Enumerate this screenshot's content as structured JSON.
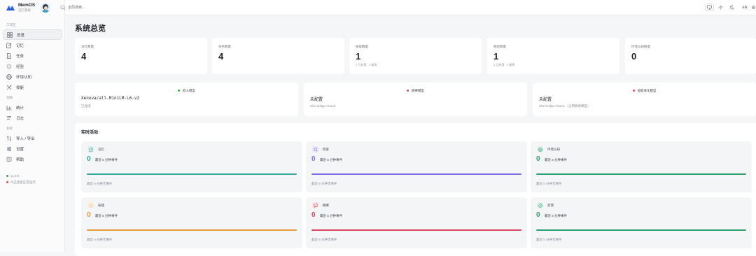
{
  "app": {
    "name": "MemOS",
    "subtitle": "记忆系统"
  },
  "search": {
    "placeholder": "全局搜索..."
  },
  "topbar": {
    "lang": "EN"
  },
  "sidebar": {
    "sections": [
      {
        "label": "工作区",
        "items": [
          {
            "label": "总览",
            "icon": "grid-icon",
            "active": true
          },
          {
            "label": "记忆",
            "icon": "edit-icon",
            "active": false
          },
          {
            "label": "任务",
            "icon": "document-icon",
            "active": false
          },
          {
            "label": "经验",
            "icon": "sparkle-icon",
            "active": false
          },
          {
            "label": "环境认知",
            "icon": "globe-icon",
            "active": false
          },
          {
            "label": "技能",
            "icon": "tools-icon",
            "active": false
          }
        ]
      },
      {
        "label": "洞察",
        "items": [
          {
            "label": "统计",
            "icon": "chart-icon",
            "active": false
          },
          {
            "label": "日志",
            "icon": "log-icon",
            "active": false
          }
        ]
      },
      {
        "label": "系统",
        "items": [
          {
            "label": "导入 / 导出",
            "icon": "transfer-icon",
            "active": false
          },
          {
            "label": "设置",
            "icon": "settings-icon",
            "active": false
          },
          {
            "label": "帮助",
            "icon": "book-icon",
            "active": false
          }
        ]
      }
    ],
    "status": [
      {
        "label": "v1.0.0",
        "color": "#2fb344"
      },
      {
        "label": "AI已连接正常运行",
        "color": "#e5484d"
      }
    ]
  },
  "main": {
    "title": "系统总览",
    "stats": [
      {
        "label": "记忆数量",
        "value": "4",
        "sub": ""
      },
      {
        "label": "任务数量",
        "value": "4",
        "sub": ""
      },
      {
        "label": "技能数量",
        "value": "1",
        "sub": "1 已启用 · 1 候选"
      },
      {
        "label": "经验数量",
        "value": "1",
        "sub": "1 已启用 · 2 候选"
      },
      {
        "label": "环境认知数量",
        "value": "0",
        "sub": ""
      }
    ],
    "models": [
      {
        "status": "嵌入模型",
        "status_color": "#2fb344",
        "name": "Xenova/all-MiniLM-L6-v2",
        "sub": "已连接",
        "mono": true
      },
      {
        "status": "摘要模型",
        "status_color": "#e5484d",
        "name": "未配置",
        "sub": "vibe bridge closed",
        "mono": false
      },
      {
        "status": "技能进化模型",
        "status_color": "#e5484d",
        "name": "未配置",
        "sub": "vibe bridge closed （沿用摘要模型）",
        "mono": false
      }
    ],
    "activity": {
      "title": "实时活动",
      "cards": [
        {
          "label": "记忆",
          "icon": "edit-icon",
          "count": "0",
          "count_sub": "最近 5 分钟事件",
          "footer": "最近 5 分钟无事件",
          "color": "#3aa6a0",
          "bg": "#dff1ef"
        },
        {
          "label": "检索",
          "icon": "search-icon",
          "count": "0",
          "count_sub": "最近 5 分钟事件",
          "footer": "最近 5 分钟无事件",
          "color": "#7c6fe0",
          "bg": "#eae6fb"
        },
        {
          "label": "环境认知",
          "icon": "globe-icon",
          "count": "0",
          "count_sub": "最近 5 分钟事件",
          "footer": "最近 5 分钟无事件",
          "color": "#2e9e6e",
          "bg": "#dff2e8"
        },
        {
          "label": "技能",
          "icon": "sparkle-icon",
          "count": "0",
          "count_sub": "最近 5 分钟事件",
          "footer": "最近 5 分钟无事件",
          "color": "#e39a3b",
          "bg": "#fbeedd"
        },
        {
          "label": "摘要",
          "icon": "chat-icon",
          "count": "0",
          "count_sub": "最近 5 分钟事件",
          "footer": "最近 5 分钟无事件",
          "color": "#d9455e",
          "bg": "#fbe2e6"
        },
        {
          "label": "反馈",
          "icon": "check-circle-icon",
          "count": "0",
          "count_sub": "最近 5 分钟事件",
          "footer": "最近 5 分钟无事件",
          "color": "#2e9e6e",
          "bg": "#dff2e8"
        }
      ]
    }
  }
}
